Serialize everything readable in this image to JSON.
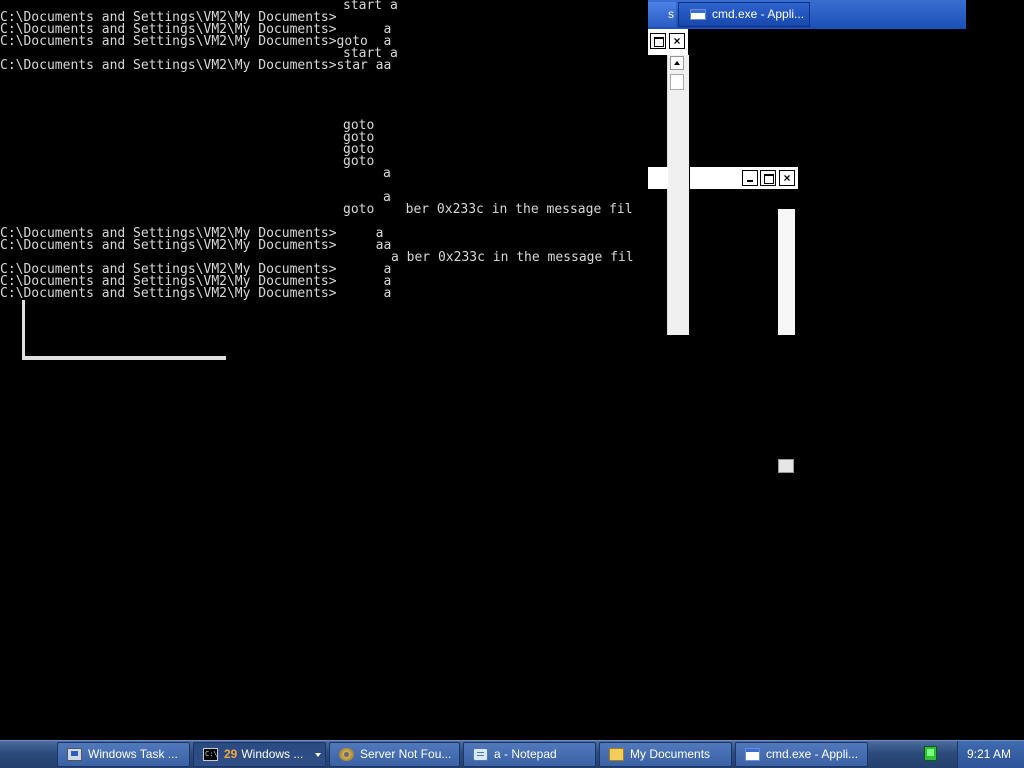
{
  "console": {
    "lines": [
      "start a",
      "C:\\Documents and Settings\\VM2\\My Documents>",
      "C:\\Documents and Settings\\VM2\\My Documents>      a",
      "C:\\Documents and Settings\\VM2\\My Documents>goto  a",
      "start a",
      "C:\\Documents and Settings\\VM2\\My Documents>star aa",
      "goto",
      "goto",
      "goto",
      "goto",
      "a",
      "a",
      "goto    ber 0x233c in the message fil",
      "C:\\Documents and Settings\\VM2\\My Documents>     a",
      "C:\\Documents and Settings\\VM2\\My Documents>     aa",
      "a ber 0x233c in the message fil",
      "C:\\Documents and Settings\\VM2\\My Documents>      a",
      "C:\\Documents and Settings\\VM2\\My Documents>      a",
      "C:\\Documents and Settings\\VM2\\My Documents>      a"
    ]
  },
  "fragments": {
    "top_left_text": "s",
    "top_task_label": "cmd.exe - Appli..."
  },
  "taskbar": {
    "buttons": [
      {
        "label": "Windows Task ...",
        "icon": "task-manager-icon"
      },
      {
        "group_count": "29",
        "label": "Windows ...",
        "icon": "cmd-icon"
      },
      {
        "label": "Server Not Fou...",
        "icon": "browser-icon"
      },
      {
        "label": "a - Notepad",
        "icon": "notepad-icon"
      },
      {
        "label": "My Documents",
        "icon": "folder-icon"
      },
      {
        "label": "cmd.exe - Appli...",
        "icon": "window-icon"
      }
    ],
    "clock": "9:21 AM",
    "tray_icon": "network-icon"
  },
  "colors": {
    "console_bg": "#000000",
    "console_text": "#d8d8d8",
    "taskbar": "#2c4a7c",
    "group_badge": "#f2a83a"
  }
}
